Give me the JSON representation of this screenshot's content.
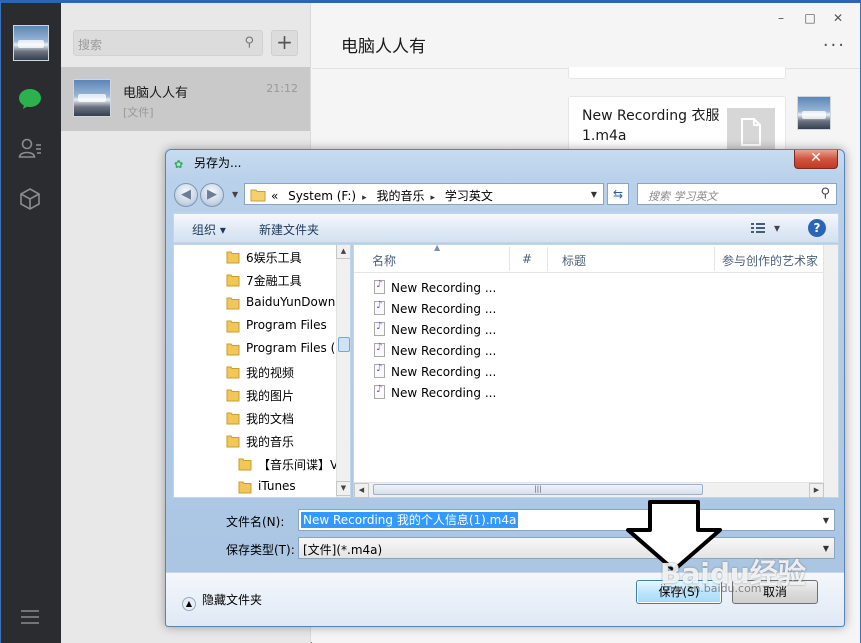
{
  "wechat": {
    "sidebar": {
      "icons": [
        "chat-icon",
        "contacts-icon",
        "collection-icon",
        "menu-icon"
      ]
    },
    "search": {
      "placeholder": "搜索",
      "add_label": "+"
    },
    "chat_list": [
      {
        "name": "电脑人人有",
        "time": "21:12",
        "preview": "[文件]"
      }
    ],
    "window_controls": {
      "minimize": "–",
      "maximize": "□",
      "close": "✕",
      "more": "···"
    },
    "chat": {
      "title": "电脑人人有",
      "file_message": {
        "name": "New Recording 衣服1.m4a"
      }
    },
    "colors": {
      "accent": "#2bb24c",
      "sidebar_bg": "#2b2c30",
      "list_bg": "#e8e8e8"
    }
  },
  "dialog": {
    "title": "另存为...",
    "close_label": "✕",
    "address": {
      "crumbs": [
        "«",
        "System (F:)",
        "我的音乐",
        "学习英文"
      ]
    },
    "search_placeholder": "搜索 学习英文",
    "toolbar": {
      "organize": "组织 ▾",
      "new_folder": "新建文件夹",
      "view": "▾",
      "help": "?"
    },
    "tree": [
      {
        "label": "6娱乐工具",
        "indent": 0
      },
      {
        "label": "7金融工具",
        "indent": 0
      },
      {
        "label": "BaiduYunDownl",
        "indent": 0
      },
      {
        "label": "Program Files",
        "indent": 0
      },
      {
        "label": "Program Files (",
        "indent": 0
      },
      {
        "label": "我的视频",
        "indent": 0
      },
      {
        "label": "我的图片",
        "indent": 0
      },
      {
        "label": "我的文档",
        "indent": 0
      },
      {
        "label": "我的音乐",
        "indent": 0
      },
      {
        "label": "【音乐间谍】V",
        "indent": 1
      },
      {
        "label": "iTunes",
        "indent": 1
      }
    ],
    "columns": [
      "名称",
      "#",
      "标题",
      "参与创作的艺术家"
    ],
    "files": [
      "New Recording ...",
      "New Recording ...",
      "New Recording ...",
      "New Recording ...",
      "New Recording ...",
      "New Recording ..."
    ],
    "filename_label": "文件名(N):",
    "filename_value": "New Recording 我的个人信息(1).m4a",
    "filetype_label": "保存类型(T):",
    "filetype_value": "[文件](*.m4a)",
    "hide_folders": "隐藏文件夹",
    "save_button": "保存(S)",
    "cancel_button": "取消"
  },
  "watermark": {
    "line1": "Baidu经验",
    "line2": "jingyan.baidu.com"
  }
}
